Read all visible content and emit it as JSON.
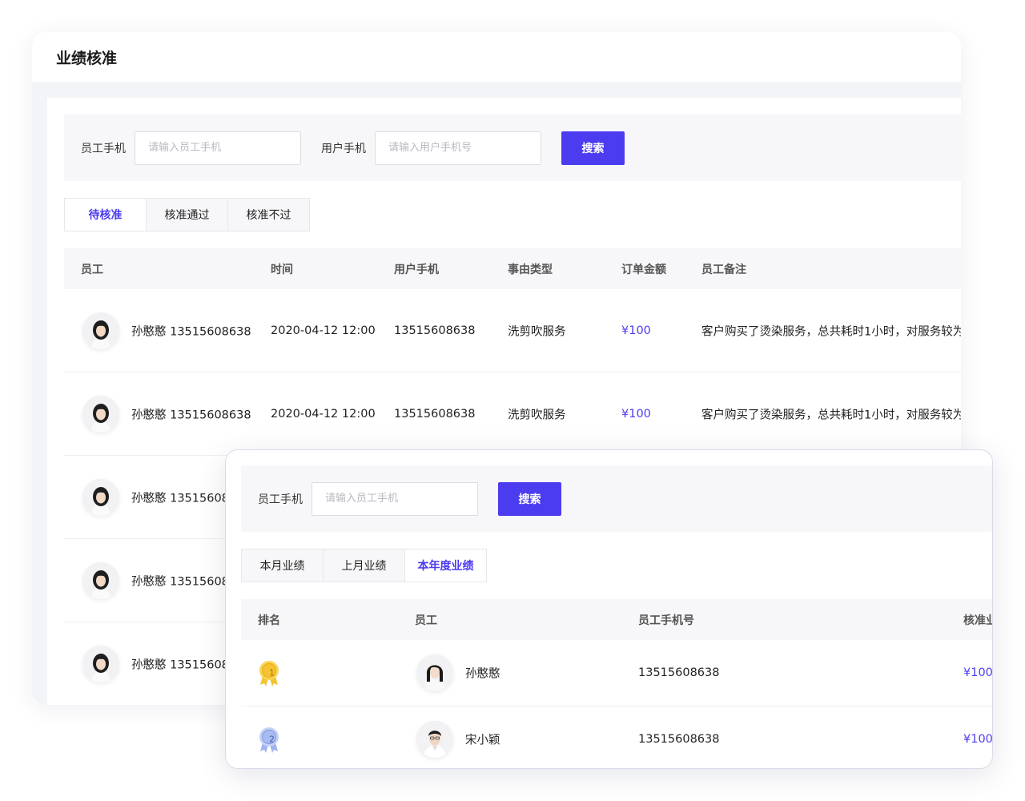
{
  "back": {
    "title": "业绩核准",
    "search": {
      "employee_phone_label": "员工手机",
      "employee_phone_placeholder": "请输入员工手机",
      "user_phone_label": "用户手机",
      "user_phone_placeholder": "请输入用户手机号",
      "search_button": "搜索"
    },
    "tabs": [
      "待核准",
      "核准通过",
      "核准不过"
    ],
    "active_tab": 0,
    "columns": [
      "员工",
      "时间",
      "用户手机",
      "事由类型",
      "订单金额",
      "员工备注"
    ],
    "rows": [
      {
        "employee": "孙憨憨 13515608638",
        "time": "2020-04-12 12:00",
        "user_phone": "13515608638",
        "type": "洗剪吹服务",
        "amount": "¥100",
        "note": "客户购买了烫染服务，总共耗时1小时，对服务较为"
      },
      {
        "employee": "孙憨憨 13515608638",
        "time": "2020-04-12 12:00",
        "user_phone": "13515608638",
        "type": "洗剪吹服务",
        "amount": "¥100",
        "note": "客户购买了烫染服务，总共耗时1小时，对服务较为"
      },
      {
        "employee": "孙憨憨 135156086"
      },
      {
        "employee": "孙憨憨 135156086"
      },
      {
        "employee": "孙憨憨 135156086"
      }
    ]
  },
  "front": {
    "search": {
      "employee_phone_label": "员工手机",
      "employee_phone_placeholder": "请输入员工手机",
      "search_button": "搜索"
    },
    "tabs": [
      "本月业绩",
      "上月业绩",
      "本年度业绩"
    ],
    "active_tab": 2,
    "columns": [
      "排名",
      "员工",
      "员工手机号",
      "核准业"
    ],
    "rows": [
      {
        "rank": "1",
        "name": "孙憨憨",
        "phone": "13515608638",
        "amount": "¥100"
      },
      {
        "rank": "2",
        "name": "宋小颖",
        "phone": "13515608638",
        "amount": "¥100"
      }
    ]
  },
  "colors": {
    "accent": "#4c3cf0",
    "gold_medal": "#f4c430",
    "silver_medal": "#9fb4ef"
  }
}
